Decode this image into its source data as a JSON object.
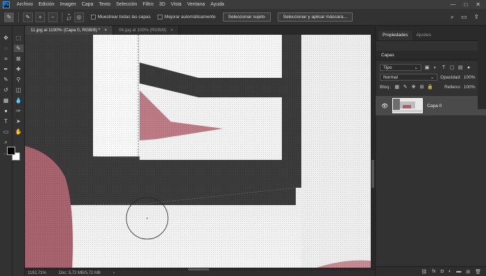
{
  "app": {
    "logo": "Ps"
  },
  "menu": [
    "Archivo",
    "Edición",
    "Imagen",
    "Capa",
    "Texto",
    "Selección",
    "Filtro",
    "3D",
    "Vista",
    "Ventana",
    "Ayuda"
  ],
  "window_controls": [
    "—",
    "□",
    "✕"
  ],
  "options_bar": {
    "brush_size": "17",
    "sample_all_label": "Muestrear todas las capas",
    "auto_enhance_label": "Mejorar automáticamente",
    "select_subject_label": "Seleccionar sujeto",
    "select_mask_label": "Seleccionar y aplicar máscara...",
    "right_icons": [
      "search-icon",
      "workspace-icon",
      "share-icon"
    ]
  },
  "document_tabs": [
    {
      "label": "11.jpg al 1190% (Capa 0, RGB/8) *",
      "close": "×",
      "active": true
    },
    {
      "label": "06.jpg al 100% (RGB/8)",
      "close": "×",
      "active": false
    }
  ],
  "status": {
    "zoom": "1192,71%",
    "doc": "Doc: 5,72 MB/5,72 MB",
    "arrow": "›"
  },
  "panels": {
    "tabs": [
      {
        "label": "Propiedades",
        "active": true
      },
      {
        "label": "Ajustes",
        "active": false
      }
    ],
    "layers_tab": "Capas",
    "filter_kind": "Tipo",
    "blend_mode": "Normal",
    "opacity_label": "Opacidad:",
    "opacity_value": "100%",
    "lock_label": "Bloq.:",
    "fill_label": "Relleno:",
    "fill_value": "100%",
    "layer": {
      "name": "Capa 0",
      "visible": true
    }
  },
  "colors": {
    "accent": "#31a8ff",
    "foreground": "#000000",
    "background": "#ffffff",
    "canvas_dark": "#3a3a3a",
    "canvas_pink": "#b8707a"
  }
}
